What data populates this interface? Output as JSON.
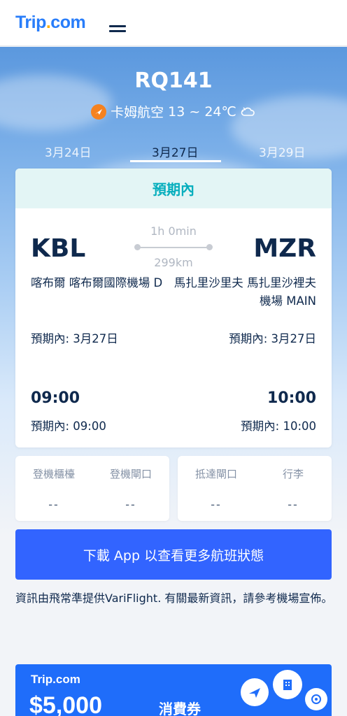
{
  "header": {
    "logo_text": "Trip",
    "logo_dot": ".",
    "logo_suffix": "com"
  },
  "flight": {
    "number": "RQ141",
    "airline": "卡姆航空",
    "temperature": "13 ~ 24℃"
  },
  "date_tabs": [
    {
      "label": "3月24日",
      "active": false
    },
    {
      "label": "3月27日",
      "active": true
    },
    {
      "label": "3月29日",
      "active": false
    }
  ],
  "status": "預期內",
  "route": {
    "duration": "1h 0min",
    "distance": "299km",
    "departure": {
      "code": "KBL",
      "airport": "喀布爾 喀布爾國際機場 D",
      "expected_date": "預期內: 3月27日",
      "time": "09:00",
      "expected_time": "預期內: 09:00"
    },
    "arrival": {
      "code": "MZR",
      "airport": "馬扎里沙里夫 馬扎里沙裡夫機場 MAIN",
      "expected_date": "預期內: 3月27日",
      "time": "10:00",
      "expected_time": "預期內: 10:00"
    }
  },
  "info": {
    "checkin_label": "登機櫃檯",
    "checkin_value": "--",
    "gate_label": "登機閘口",
    "gate_value": "--",
    "arrival_gate_label": "抵達閘口",
    "arrival_gate_value": "--",
    "baggage_label": "行李",
    "baggage_value": "--"
  },
  "cta_label": "下載 App 以查看更多航班狀態",
  "note": "資訊由飛常準提供VariFlight. 有關最新資訊，請參考機場宣佈。",
  "banner": {
    "logo": "Trip.com",
    "amount": "$5,000",
    "coupon": "消費券"
  },
  "colors": {
    "brand": "#287dfa",
    "status": "#06aebd",
    "cta": "#3264ff"
  },
  "icons": [
    "menu-icon",
    "airline-logo-icon",
    "weather-icon",
    "plane-icon",
    "hotel-icon",
    "attraction-icon"
  ]
}
